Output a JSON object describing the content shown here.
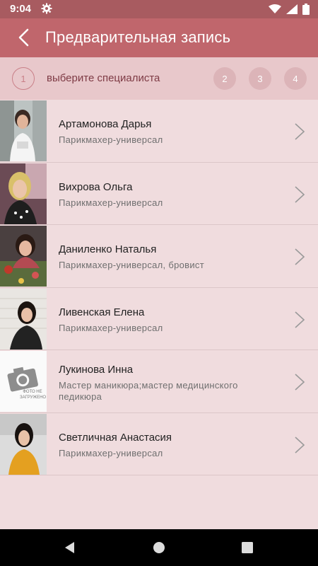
{
  "status_bar": {
    "time": "9:04",
    "settings_icon": "gear-icon",
    "wifi_icon": "wifi-icon",
    "signal_icon": "signal-icon",
    "battery_icon": "battery-icon"
  },
  "header": {
    "title": "Предварительная запись",
    "back_icon": "back-arrow-icon",
    "color": "#c0666c"
  },
  "steps": {
    "current_number": "1",
    "current_label": "выберите специалиста",
    "next_steps": [
      "2",
      "3",
      "4"
    ]
  },
  "specialists": [
    {
      "name": "Артамонова Дарья",
      "role": "Парикмахер-универсал"
    },
    {
      "name": "Вихрова Ольга",
      "role": "Парикмахер-универсал"
    },
    {
      "name": "Даниленко Наталья",
      "role": "Парикмахер-универсал, бровист"
    },
    {
      "name": "Ливенская Елена",
      "role": "Парикмахер-универсал"
    },
    {
      "name": "Лукинова Инна",
      "role": "Мастер маникюра;мастер медицинского педикюра",
      "photo_placeholder": "ФОТО НЕ ЗАГРУЖЕНО"
    },
    {
      "name": "Светличная Анастасия",
      "role": "Парикмахер-универсал"
    }
  ],
  "navigation": {
    "back": "nav-back-icon",
    "home": "nav-home-icon",
    "recents": "nav-recents-icon"
  }
}
